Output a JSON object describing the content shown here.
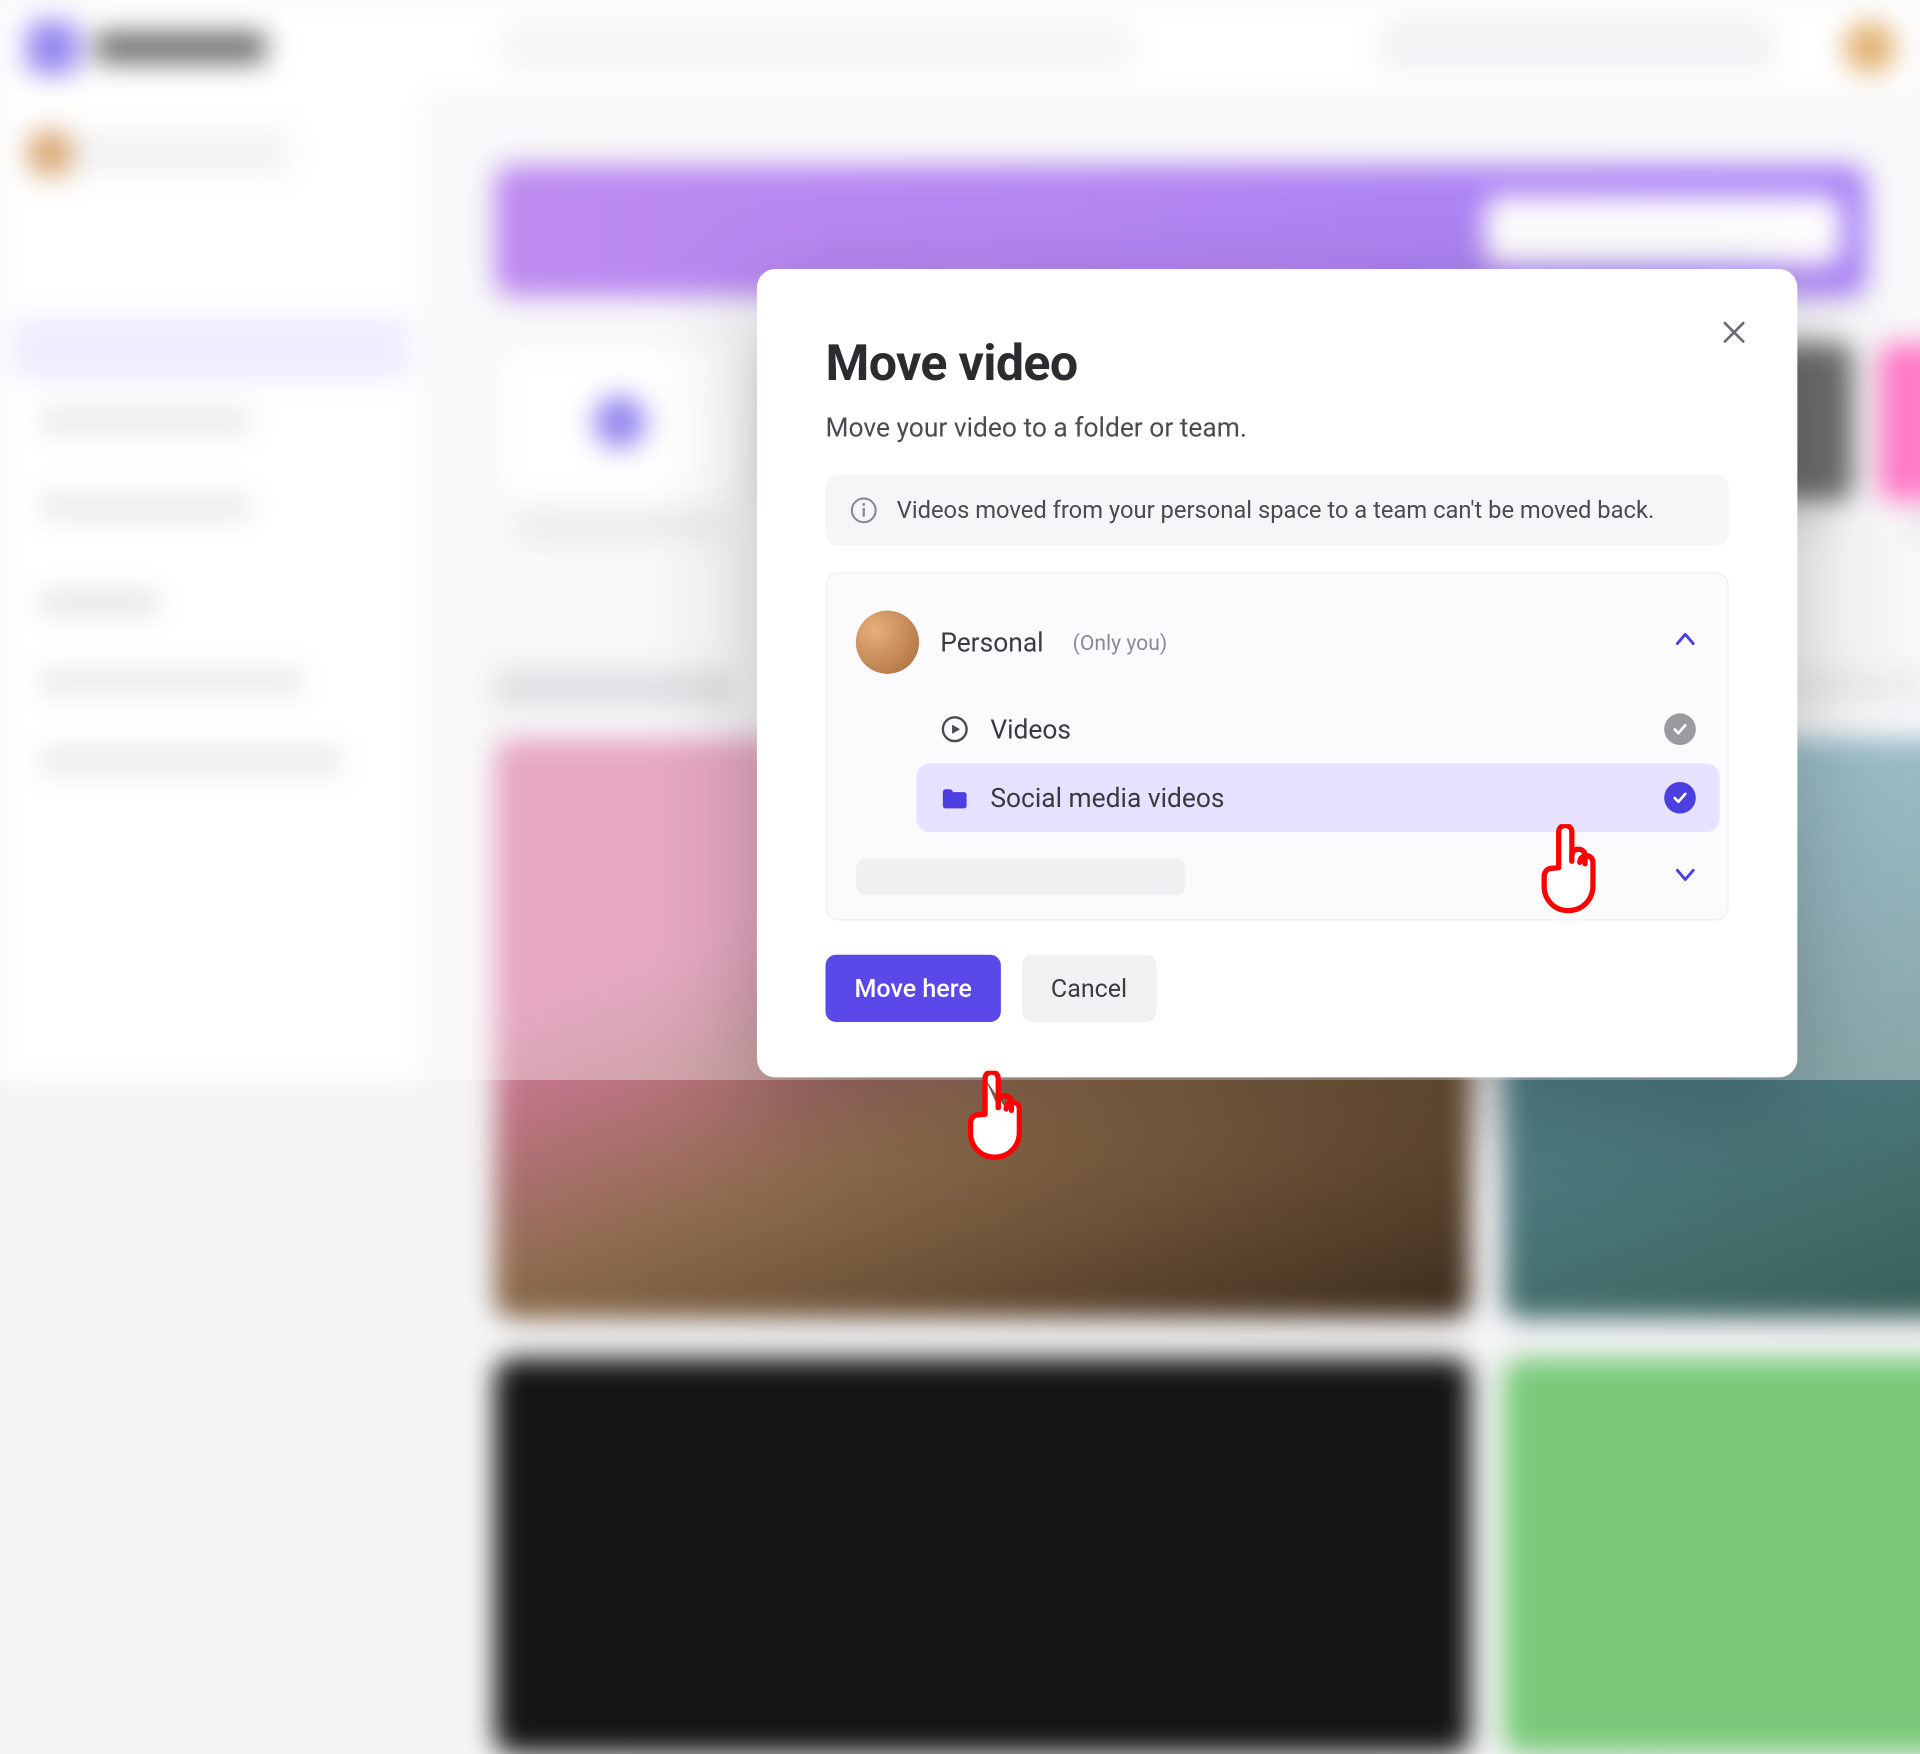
{
  "modal": {
    "title": "Move video",
    "subtitle": "Move your video to a folder or team.",
    "info": "Videos moved from your personal space to a team can't be moved back.",
    "root": {
      "name": "Personal",
      "scope": "(Only you)"
    },
    "children": [
      {
        "icon": "video",
        "label": "Videos",
        "selected": false
      },
      {
        "icon": "folder",
        "label": "Social media videos",
        "selected": true
      }
    ],
    "primary": "Move here",
    "secondary": "Cancel"
  }
}
